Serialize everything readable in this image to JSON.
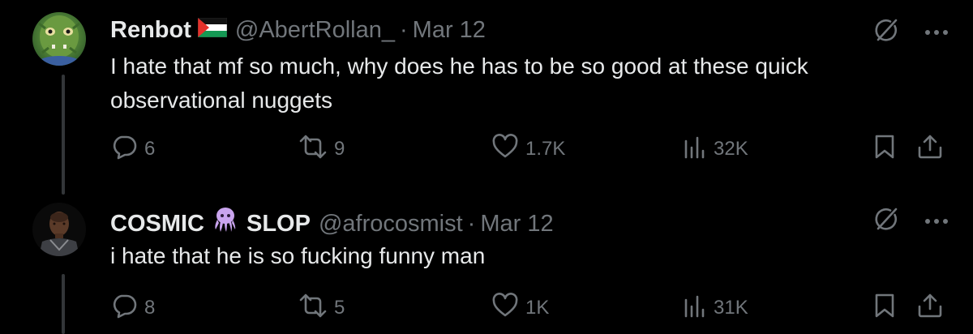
{
  "tweets": [
    {
      "display_name": "Renbot",
      "name_emoji": "palestine-flag",
      "handle": "@AbertRollan_",
      "separator": "·",
      "date": "Mar 12",
      "text": "I hate that mf so much, why does he has to be so good at these quick observational nuggets",
      "stats": {
        "replies": "6",
        "retweets": "9",
        "likes": "1.7K",
        "views": "32K"
      }
    },
    {
      "display_name_parts": [
        "COSMIC",
        "SLOP"
      ],
      "name_emoji": "octopus",
      "handle": "@afrocosmist",
      "separator": "·",
      "date": "Mar 12",
      "text": "i hate that he is so fucking funny man",
      "stats": {
        "replies": "8",
        "retweets": "5",
        "likes": "1K",
        "views": "31K"
      }
    }
  ],
  "colors": {
    "background": "#000000",
    "primary_text": "#e7e9ea",
    "secondary_text": "#71767b",
    "thread_line": "#333639",
    "octopus": "#c9a4ee"
  },
  "icons": [
    "grok-icon",
    "more-icon",
    "reply-icon",
    "retweet-icon",
    "like-icon",
    "views-icon",
    "bookmark-icon",
    "share-icon"
  ]
}
